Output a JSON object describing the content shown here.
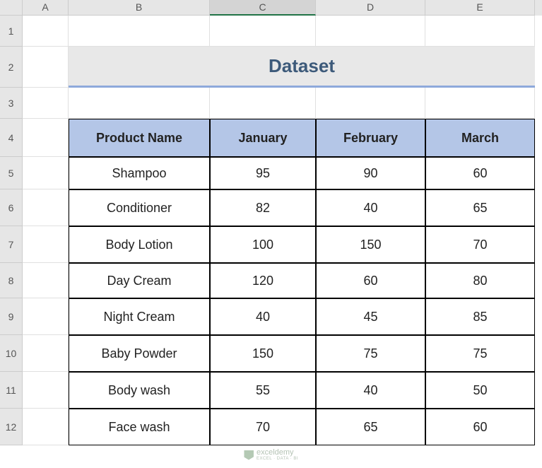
{
  "columns": [
    "A",
    "B",
    "C",
    "D",
    "E"
  ],
  "rows": [
    "1",
    "2",
    "3",
    "4",
    "5",
    "6",
    "7",
    "8",
    "9",
    "10",
    "11",
    "12"
  ],
  "selected_column_index": 2,
  "title": "Dataset",
  "table": {
    "headers": [
      "Product Name",
      "January",
      "February",
      "March"
    ],
    "data": [
      [
        "Shampoo",
        "95",
        "90",
        "60"
      ],
      [
        "Conditioner",
        "82",
        "40",
        "65"
      ],
      [
        "Body Lotion",
        "100",
        "150",
        "70"
      ],
      [
        "Day Cream",
        "120",
        "60",
        "80"
      ],
      [
        "Night Cream",
        "40",
        "45",
        "85"
      ],
      [
        "Baby Powder",
        "150",
        "75",
        "75"
      ],
      [
        "Body wash",
        "55",
        "40",
        "50"
      ],
      [
        "Face wash",
        "70",
        "65",
        "60"
      ]
    ]
  },
  "row_heights": [
    "46",
    "52",
    "52",
    "50",
    "52",
    "52",
    "52",
    "52"
  ],
  "watermark": {
    "brand": "exceldemy",
    "tagline": "EXCEL · DATA · BI"
  }
}
